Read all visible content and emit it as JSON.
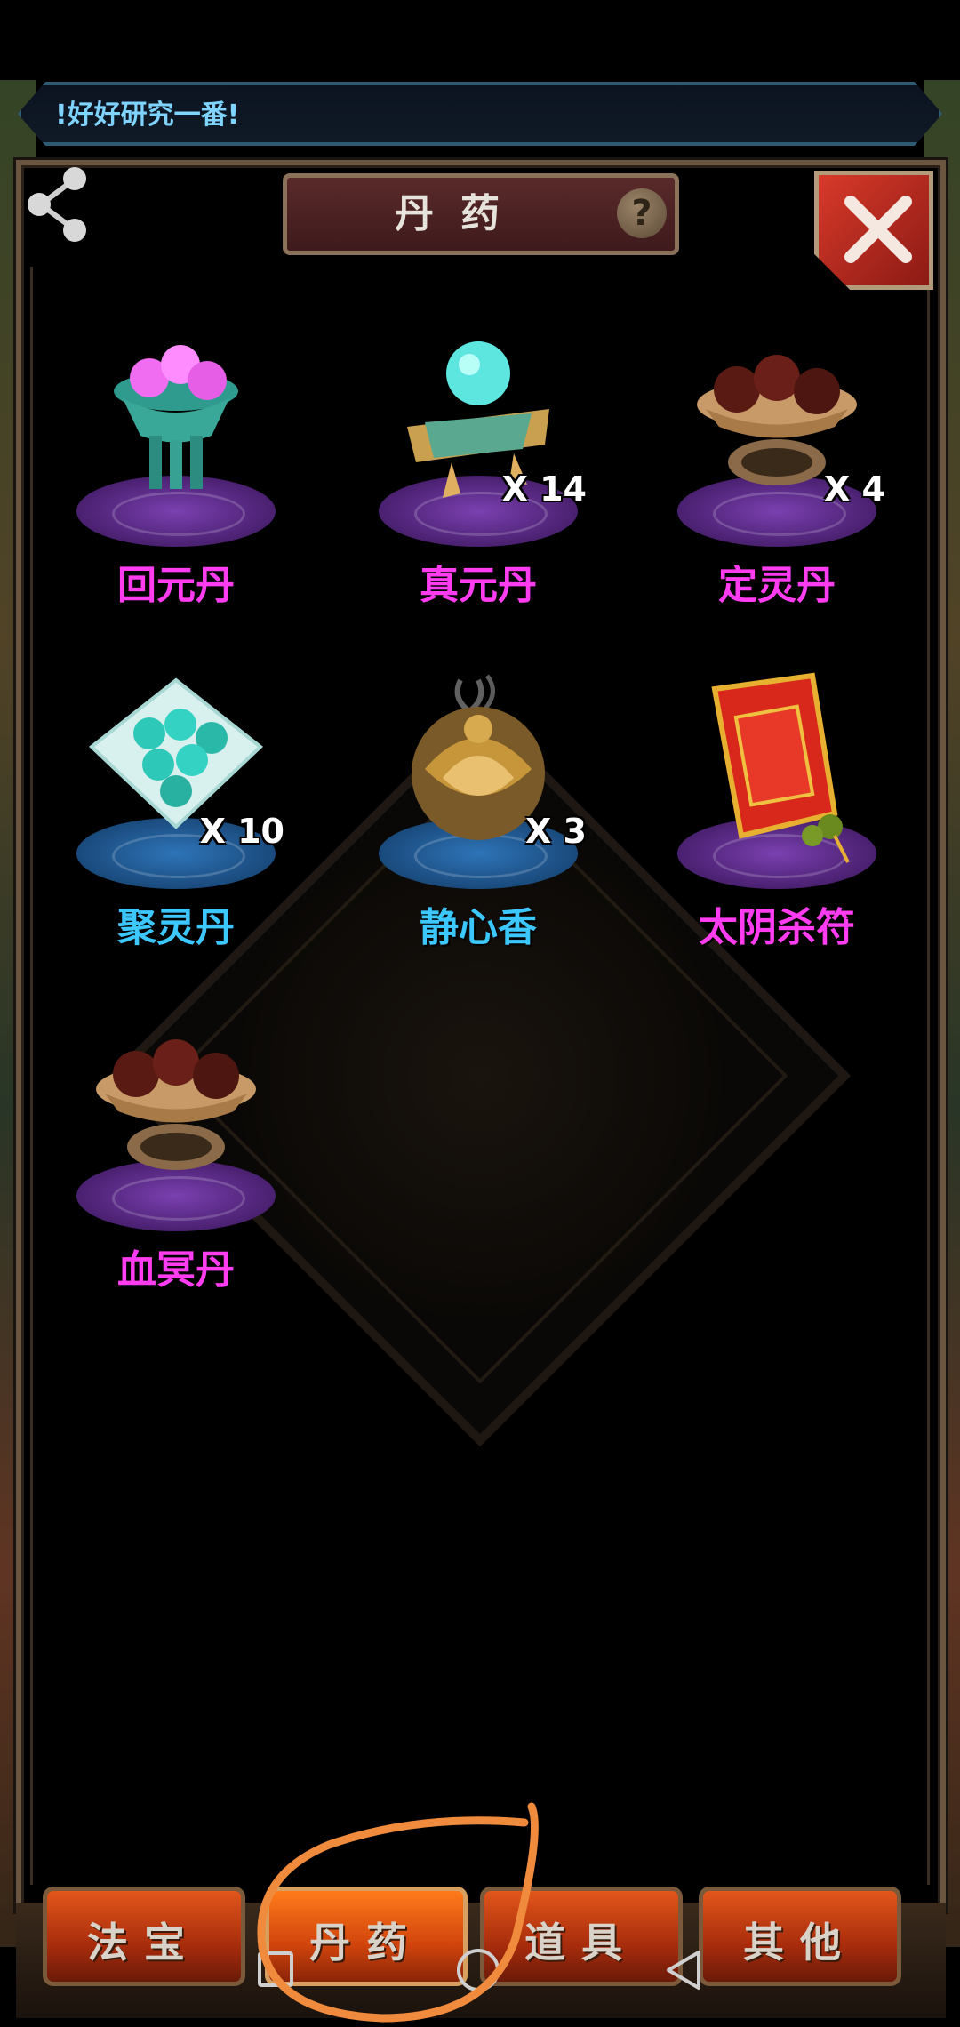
{
  "notice": {
    "text": "!好好研究一番!"
  },
  "header": {
    "title": "丹药",
    "help_symbol": "?"
  },
  "items": [
    {
      "name": "回元丹",
      "count": "",
      "label_color": "#ff3cf0",
      "pedestal": "purple",
      "art_icon": "jade-bowl-pink-pills-icon"
    },
    {
      "name": "真元丹",
      "count": "X 14",
      "label_color": "#ff3cf0",
      "pedestal": "purple",
      "art_icon": "jade-orb-scroll-icon"
    },
    {
      "name": "定灵丹",
      "count": "X 4",
      "label_color": "#ff3cf0",
      "pedestal": "purple",
      "art_icon": "bowl-dark-pills-icon"
    },
    {
      "name": "聚灵丹",
      "count": "X 10",
      "label_color": "#3cc8ff",
      "pedestal": "blue",
      "art_icon": "cloth-teal-pills-icon"
    },
    {
      "name": "静心香",
      "count": "X 3",
      "label_color": "#3cc8ff",
      "pedestal": "blue",
      "art_icon": "golden-incense-burner-icon"
    },
    {
      "name": "太阴杀符",
      "count": "",
      "label_color": "#ff3cf0",
      "pedestal": "purple",
      "art_icon": "red-talisman-icon"
    },
    {
      "name": "血冥丹",
      "count": "",
      "label_color": "#ff3cf0",
      "pedestal": "purple",
      "art_icon": "bowl-dark-pills-icon"
    }
  ],
  "tabs": [
    {
      "label": "法宝",
      "active": false
    },
    {
      "label": "丹药",
      "active": true
    },
    {
      "label": "道具",
      "active": false
    },
    {
      "label": "其他",
      "active": false
    }
  ],
  "colors": {
    "accent_magenta": "#ff3cf0",
    "accent_cyan": "#3cc8ff",
    "close_red": "#d83a2a",
    "annotation_orange": "#f08a3c"
  }
}
